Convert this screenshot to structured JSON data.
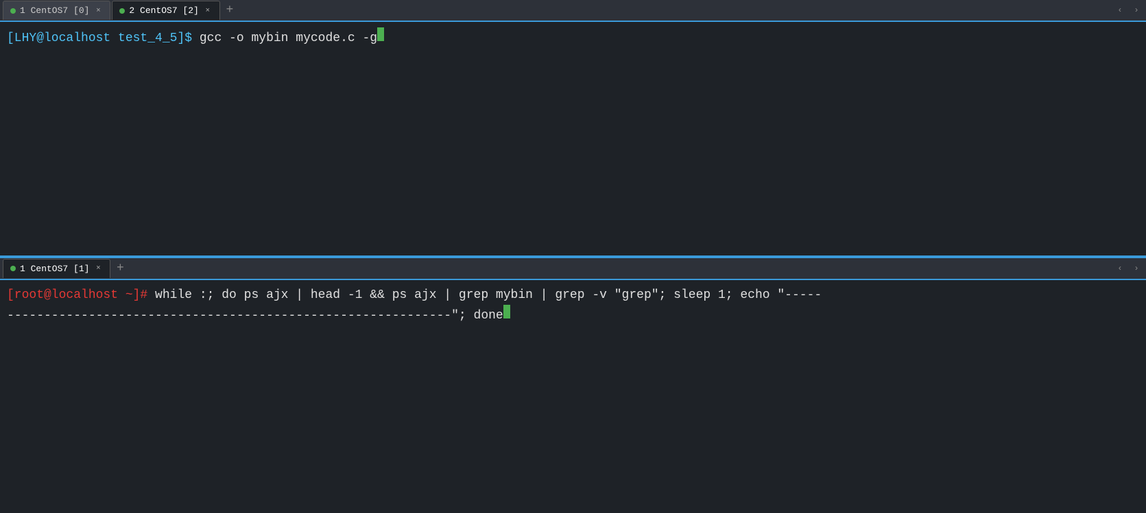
{
  "top_pane": {
    "tabs": [
      {
        "id": "tab1",
        "label": "1 CentOS7 [0]",
        "active": false,
        "dot": true,
        "closeable": true
      },
      {
        "id": "tab2",
        "label": "2 CentOS7 [2]",
        "active": true,
        "dot": true,
        "closeable": true
      }
    ],
    "add_tab_label": "+",
    "prompt": "[LHY@localhost test_4_5]$",
    "command": " gcc -o mybin mycode.c -g"
  },
  "bottom_pane": {
    "tabs": [
      {
        "id": "tab3",
        "label": "1 CentOS7 [1]",
        "active": true,
        "dot": true,
        "closeable": true
      }
    ],
    "add_tab_label": "+",
    "prompt": "[root@localhost ~]#",
    "command_line1": " while :; do ps ajx | head -1 && ps ajx | grep mybin | grep -v \"grep\"; sleep 1; echo \"-----",
    "command_line2": "------------------------------------------------------------\"; done"
  },
  "icons": {
    "close": "×",
    "add": "+",
    "arrow_left": "‹",
    "arrow_right": "›"
  },
  "colors": {
    "active_tab_bg": "#1e2227",
    "inactive_tab_bg": "#3c4049",
    "tab_bar_bg": "#2d3139",
    "terminal_bg": "#1e2227",
    "accent": "#3a9ad9",
    "dot_active": "#4caf50",
    "prompt_user_color": "#4fc3f7",
    "prompt_root_color": "#e53935",
    "text": "#e0e0e0",
    "cursor_color": "#4caf50"
  }
}
